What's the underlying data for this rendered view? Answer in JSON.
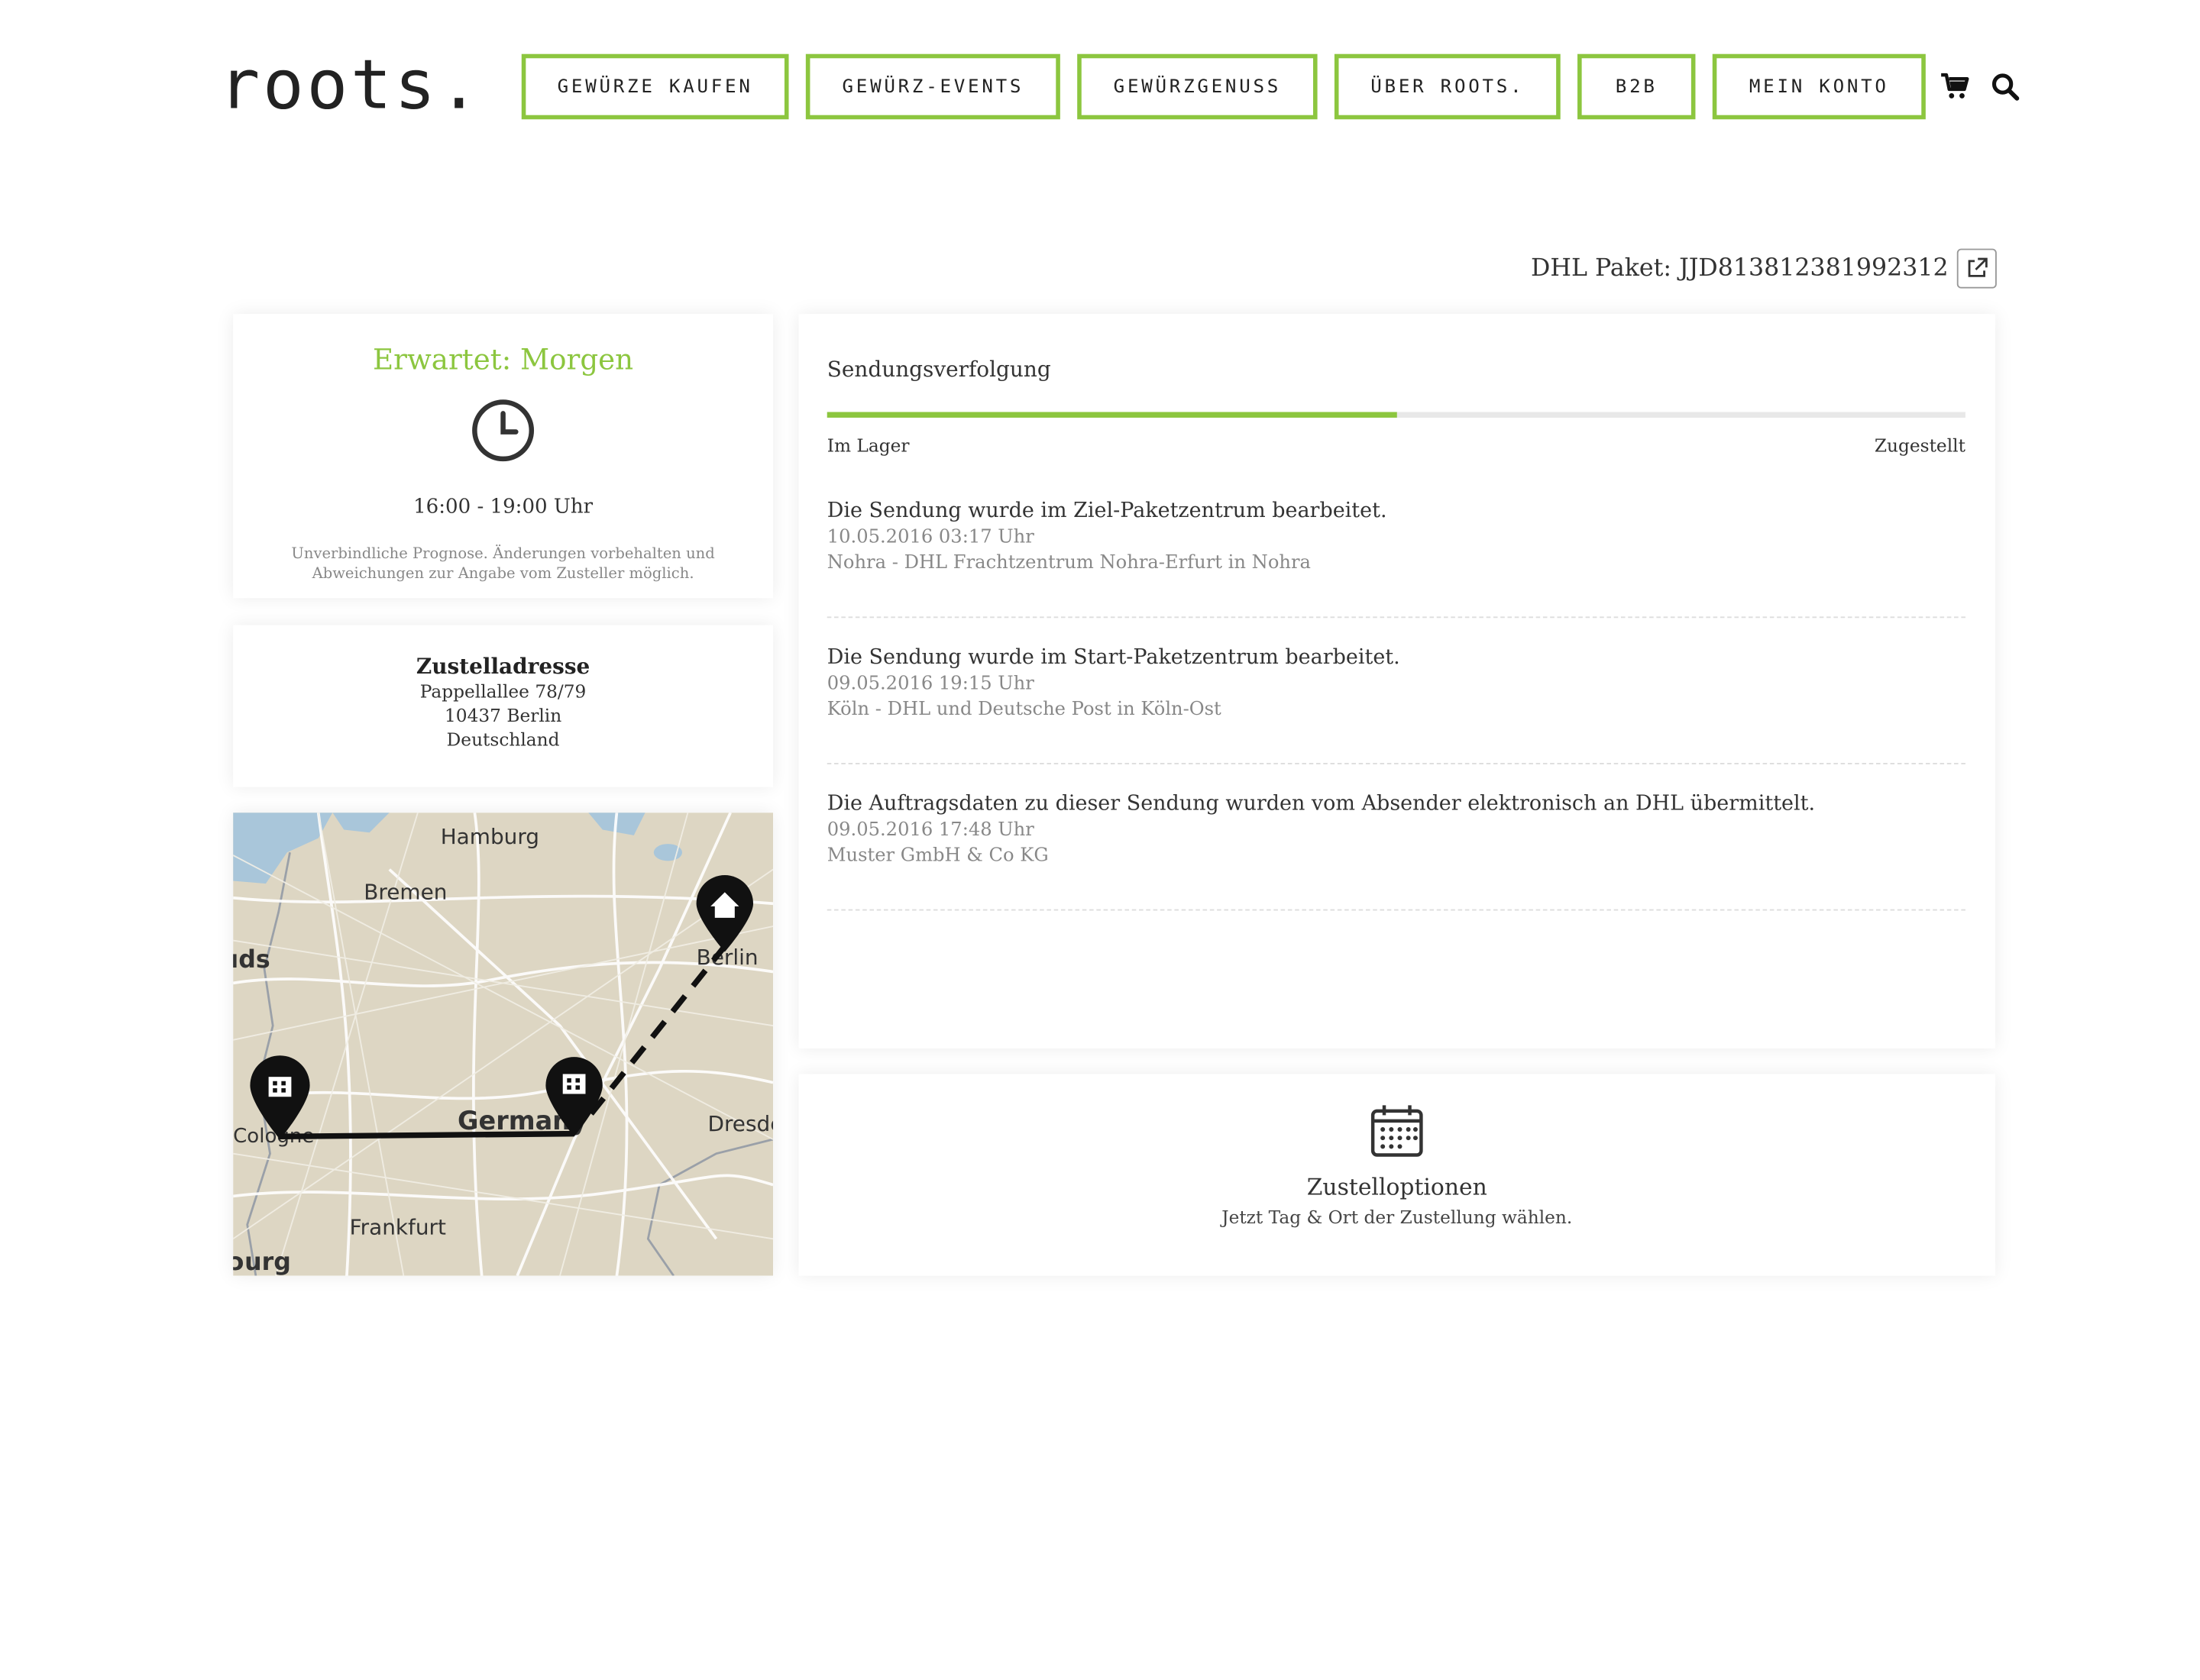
{
  "brand": {
    "logo_text": "roots.",
    "accent_color": "#8cc63f"
  },
  "nav": [
    {
      "label": "Gewürze kaufen"
    },
    {
      "label": "Gewürz-Events"
    },
    {
      "label": "Gewürzgenuss"
    },
    {
      "label": "Über roots."
    },
    {
      "label": "B2B"
    },
    {
      "label": "Mein Konto"
    }
  ],
  "header_icons": {
    "cart": "cart-icon",
    "search": "search-icon"
  },
  "tracking": {
    "label": "DHL Paket: JJD813812381992312",
    "link_icon": "external-link-icon"
  },
  "eta": {
    "title": "Erwartet: Morgen",
    "icon": "clock-icon",
    "time": "16:00 - 19:00 Uhr",
    "note": "Unverbindliche Prognose. Änderungen vorbehalten und Abweichungen zur Angabe vom Zusteller möglich."
  },
  "address": {
    "title": "Zustelladresse",
    "lines": [
      "Pappellallee 78/79",
      "10437 Berlin",
      "Deutschland"
    ]
  },
  "map": {
    "labels": [
      "Hamburg",
      "Bremen",
      "ıds",
      "Berlin",
      "Cologne",
      "Germany",
      "Dresde",
      "Frankfurt",
      "ɔurg"
    ]
  },
  "shipment": {
    "title": "Sendungsverfolgung",
    "progress": 0.5,
    "start_label": "Im Lager",
    "end_label": "Zugestellt",
    "events": [
      {
        "title": "Die Sendung wurde im Ziel-Paketzentrum bearbeitet.",
        "date": "10.05.2016 03:17 Uhr",
        "place": "Nohra - DHL Frachtzentrum Nohra-Erfurt in Nohra"
      },
      {
        "title": "Die Sendung wurde im Start-Paketzentrum bearbeitet.",
        "date": "09.05.2016 19:15 Uhr",
        "place": "Köln - DHL und Deutsche Post in Köln-Ost"
      },
      {
        "title": "Die Auftragsdaten zu dieser Sendung wurden vom Absender elektronisch an DHL übermittelt.",
        "date": "09.05.2016 17:48 Uhr",
        "place": "Muster GmbH & Co KG"
      }
    ]
  },
  "options": {
    "icon": "calendar-icon",
    "title": "Zustelloptionen",
    "subtitle": "Jetzt Tag & Ort der Zustellung wählen."
  }
}
